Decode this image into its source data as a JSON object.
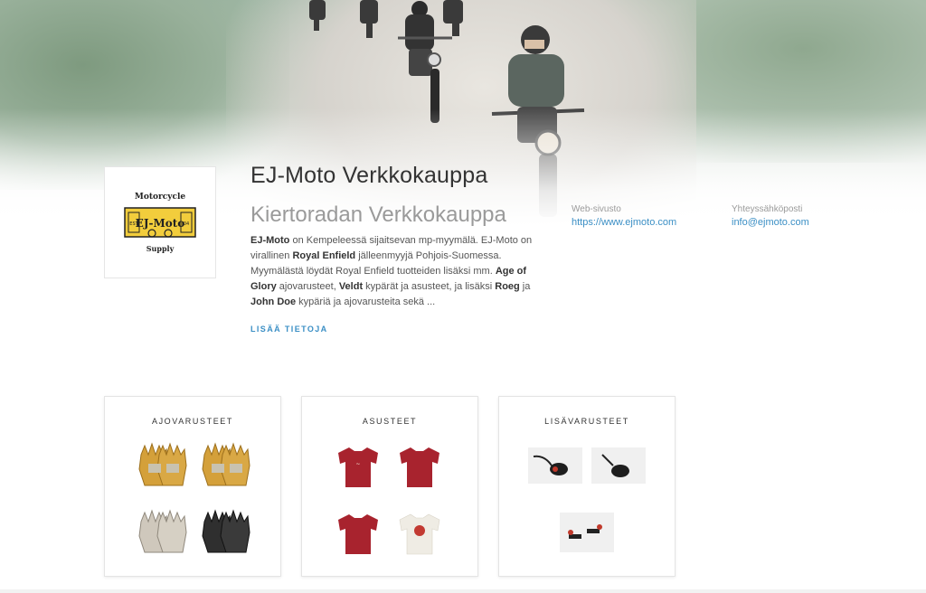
{
  "store": {
    "title": "EJ-Moto Verkkokauppa",
    "subtitle": "Kiertoradan Verkkokauppa",
    "logo": {
      "top_text": "Motorcycle",
      "main_text": "EJ-Moto",
      "left_badge": "EST",
      "right_badge": "04",
      "bottom_text": "Supply"
    },
    "description": {
      "p1_bold": "EJ-Moto",
      "p1": " on Kempeleessä sijaitsevan mp-myymälä. EJ-Moto on virallinen ",
      "p2_bold": "Royal Enfield",
      "p2": " jälleenmyyjä Pohjois-Suomessa. Myymälästä löydät Royal Enfield tuotteiden lisäksi mm. ",
      "p3_bold": "Age of Glory",
      "p3": " ajovarusteet, ",
      "p4_bold": "Veldt",
      "p4": " kypärät ja asusteet, ja lisäksi ",
      "p5_bold": "Roeg",
      "p5": " ja ",
      "p6_bold": "John Doe",
      "p6": " kypäriä ja ajovarusteita sekä ..."
    },
    "more_label": "LISÄÄ TIETOJA"
  },
  "contact": {
    "web_label": "Web-sivusto",
    "web_value": "https://www.ejmoto.com",
    "email_label": "Yhteyssähköposti",
    "email_value": "info@ejmoto.com"
  },
  "categories": [
    {
      "title": "AJOVARUSTEET"
    },
    {
      "title": "ASUSTEET"
    },
    {
      "title": "LISÄVARUSTEET"
    }
  ],
  "colors": {
    "link": "#3b8fc5",
    "glove_tan": "#d4a03a",
    "tshirt_red": "#a8232e",
    "logo_yellow": "#f2cd3c"
  }
}
